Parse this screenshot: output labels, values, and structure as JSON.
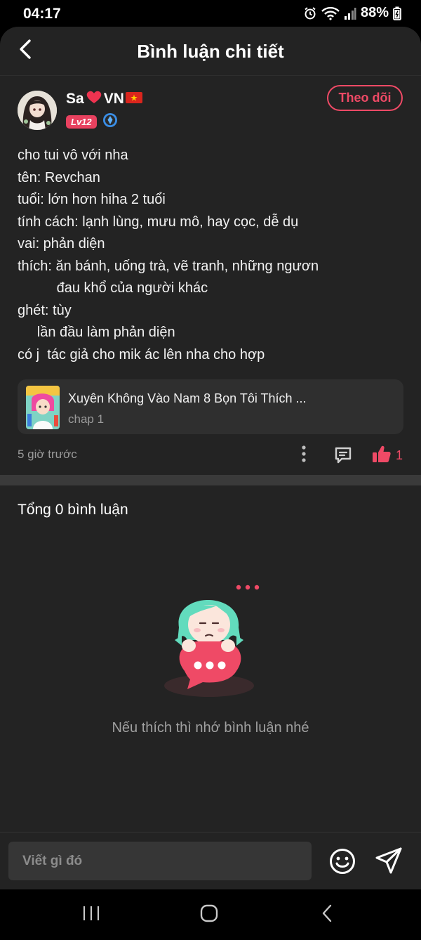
{
  "status_bar": {
    "time": "04:17",
    "battery": "88%",
    "icons": [
      "alarm-icon",
      "wifi-icon",
      "signal-icon",
      "battery-icon"
    ]
  },
  "header": {
    "title": "Bình luận chi tiết",
    "back_icon": "chevron-left-icon"
  },
  "comment": {
    "username": "Sa",
    "username_suffix": "VN",
    "username_emojis": [
      "red-heart",
      "vietnam-flag"
    ],
    "level": "Lv12",
    "follow_label": "Theo dõi",
    "lines": [
      "cho tui vô với nha",
      "tên: Revchan",
      "tuổi: lớn hơn hiha 2 tuổi",
      "tính cách: lạnh lùng, mưu mô, hay cọc, dễ dụ",
      "vai: phản diện",
      "thích: ăn bánh, uống trà, vẽ tranh, những ngươn",
      "          đau khổ của người khác",
      "ghét: tùy",
      "     lần đầu làm phản diện",
      "có j  tác giả cho mik ác lên nha cho hợp"
    ],
    "story": {
      "title": "Xuyên Không Vào Nam 8 Bọn Tôi Thích ...",
      "chapter": "chap 1"
    },
    "time_ago": "5 giờ trước",
    "like_count": "1"
  },
  "replies": {
    "total_label": "Tổng 0 bình luận",
    "empty_message": "Nếu thích thì nhớ bình luận nhé"
  },
  "input": {
    "placeholder": "Viết gì đó"
  },
  "colors": {
    "accent": "#ef4a66",
    "background": "#232323",
    "card": "#2f2f2f",
    "muted_text": "#9a9a9a"
  }
}
